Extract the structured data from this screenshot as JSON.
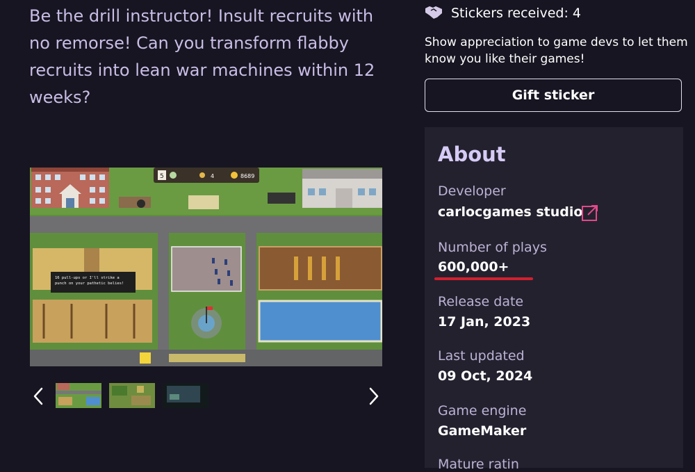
{
  "description": "Be the drill instructor! Insult recruits with no remorse! Can you transform flabby recruits into lean war machines within 12 weeks?",
  "game_hud": {
    "day": "5",
    "count": "4",
    "money": "8689",
    "speech": "16 pull-ups or I'll strike a punch on your pathetic belies!"
  },
  "stickers": {
    "label": "Stickers received: 4"
  },
  "appreciation": "Show appreciation to game devs to let them know you like their games!",
  "gift_button": "Gift sticker",
  "about": {
    "title": "About",
    "developer_label": "Developer",
    "developer": "carlocgames studio",
    "plays_label": "Number of plays",
    "plays": "600,000+",
    "release_label": "Release date",
    "release": "17 Jan, 2023",
    "updated_label": "Last updated",
    "updated": "09 Oct, 2024",
    "engine_label": "Game engine",
    "engine": "GameMaker",
    "partial_label": "Mature ratin"
  },
  "colors": {
    "accent_purple": "#d6cbf5",
    "underline_red": "#d21f2e",
    "panel": "#24212f",
    "external_link": "#e04a8a"
  },
  "icons": [
    "previous-arrow-icon",
    "next-arrow-icon",
    "sticker-handshake-icon",
    "external-link-icon"
  ]
}
